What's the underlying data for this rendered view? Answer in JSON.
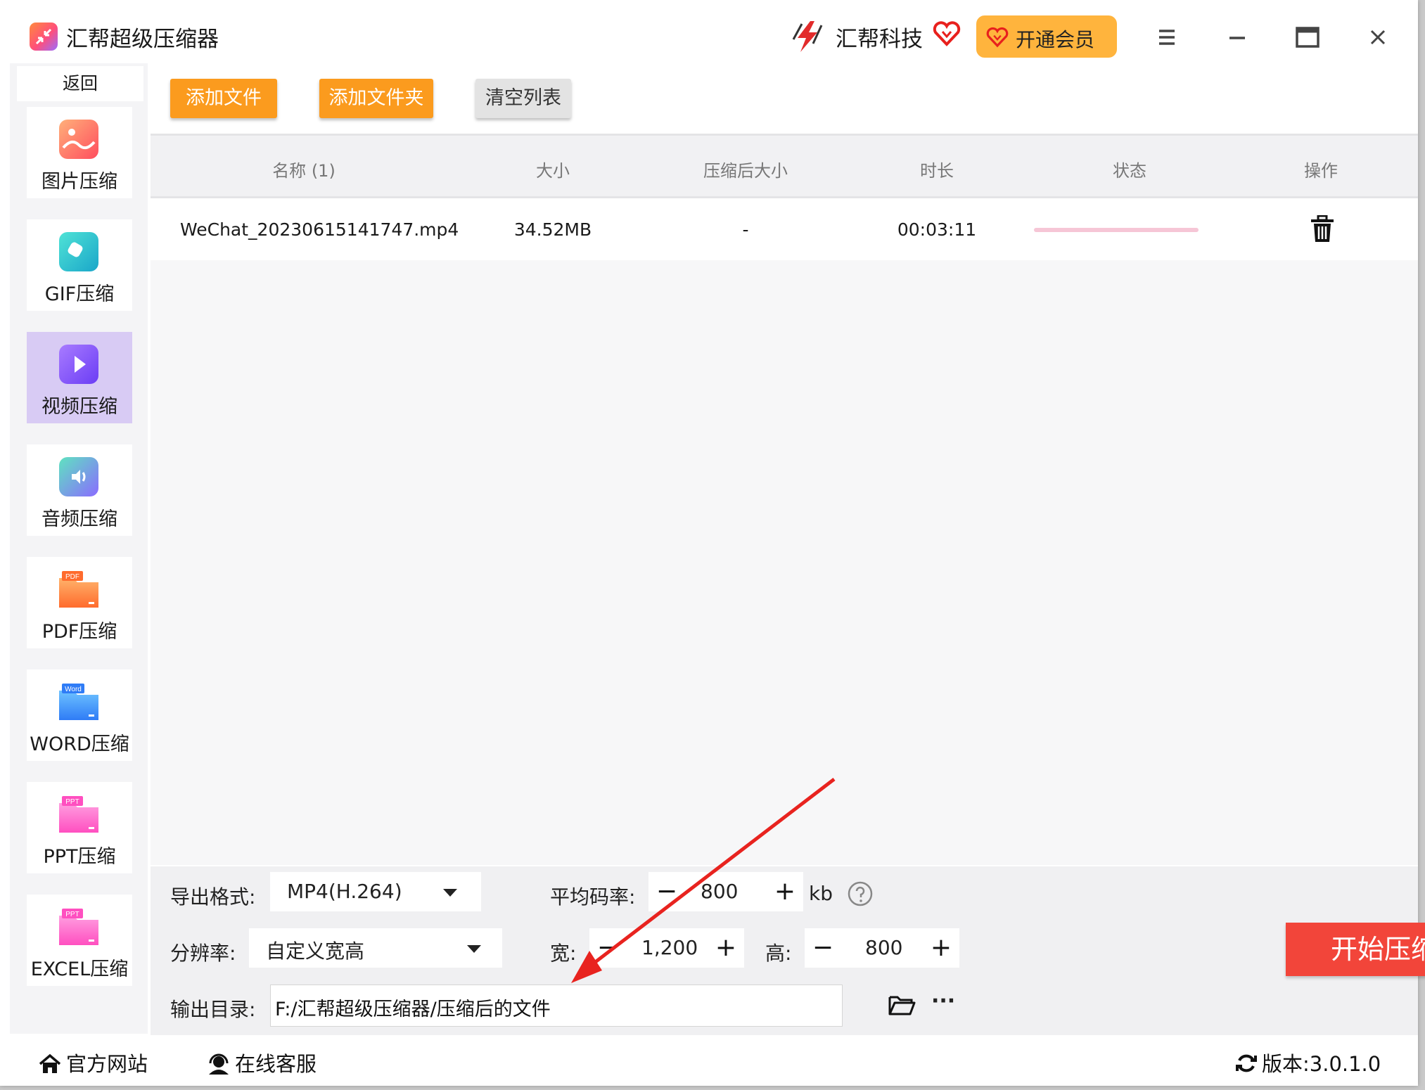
{
  "window": {
    "title": "汇帮超级压缩器",
    "brand": "汇帮科技",
    "vip_label": "开通会员"
  },
  "sidebar": {
    "back_label": "返回",
    "items": [
      {
        "label": "图片压缩"
      },
      {
        "label": "GIF压缩"
      },
      {
        "label": "视频压缩",
        "active": true
      },
      {
        "label": "音频压缩"
      },
      {
        "label": "PDF压缩",
        "badge": "PDF"
      },
      {
        "label": "WORD压缩",
        "badge": "Word"
      },
      {
        "label": "PPT压缩",
        "badge": "PPT"
      },
      {
        "label": "EXCEL压缩",
        "badge": "PPT"
      }
    ]
  },
  "toolbar": {
    "add_file": "添加文件",
    "add_folder": "添加文件夹",
    "clear_list": "清空列表"
  },
  "table": {
    "columns": [
      "名称 (1)",
      "大小",
      "压缩后大小",
      "时长",
      "状态",
      "操作"
    ],
    "rows": [
      {
        "name": "WeChat_20230615141747.mp4",
        "size": "34.52MB",
        "compressed_size": "-",
        "duration": "00:03:11"
      }
    ]
  },
  "settings": {
    "format_label": "导出格式:",
    "format_value": "MP4(H.264)",
    "bitrate_label": "平均码率:",
    "bitrate_value": "800",
    "bitrate_unit": "kb",
    "resolution_label": "分辨率:",
    "resolution_value": "自定义宽高",
    "width_label": "宽:",
    "width_value": "1,200",
    "height_label": "高:",
    "height_value": "800",
    "output_label": "输出目录:",
    "output_path": "F:/汇帮超级压缩器/压缩后的文件",
    "more": "···",
    "start_button": "开始压缩"
  },
  "footer": {
    "website": "官方网站",
    "support": "在线客服",
    "version": "版本:3.0.1.0"
  },
  "colors": {
    "accent_orange": "#fb9b1e",
    "vip_yellow": "#ffb43d",
    "start_red": "#f2453a",
    "active_nav": "#d8cbf4",
    "arrow_red": "#e8231f"
  }
}
